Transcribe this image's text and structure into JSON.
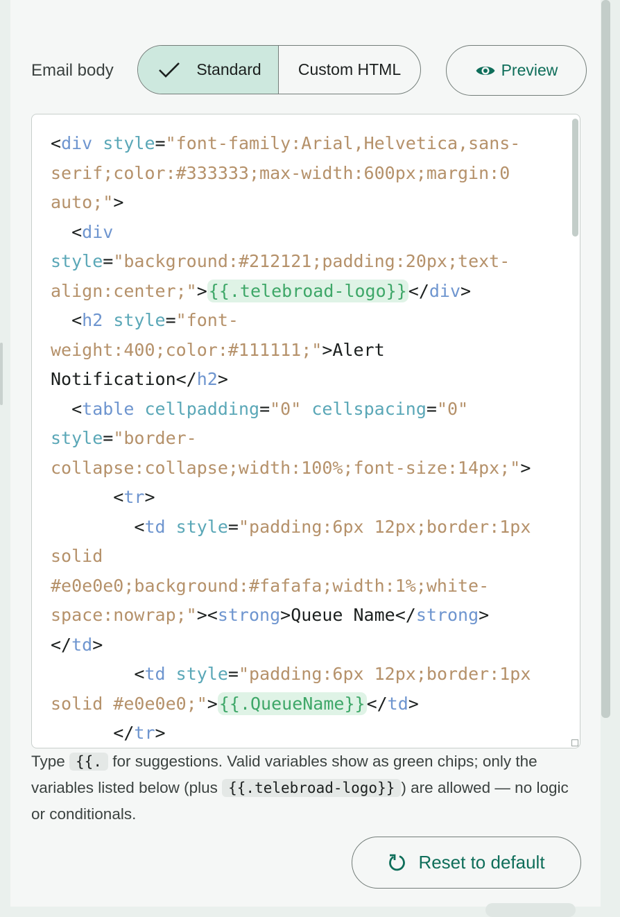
{
  "email_body": {
    "label": "Email body",
    "mode_options": [
      "Standard",
      "Custom HTML"
    ],
    "selected_mode": "Standard",
    "preview_label": "Preview"
  },
  "code_lines": [
    [
      [
        "p",
        "<"
      ],
      [
        "tag",
        "div"
      ],
      [
        "p",
        " "
      ],
      [
        "attr",
        "style"
      ],
      [
        "p",
        "="
      ],
      [
        "val",
        "\"font-family:Arial,Helvetica,sans-"
      ]
    ],
    [
      [
        "val",
        "serif;color:#333333;max-width:600px;margin:0"
      ]
    ],
    [
      [
        "val",
        "auto;\""
      ],
      [
        "p",
        ">"
      ]
    ],
    [
      [
        "p",
        "  <"
      ],
      [
        "tag",
        "div"
      ]
    ],
    [
      [
        "attr",
        "style"
      ],
      [
        "p",
        "="
      ],
      [
        "val",
        "\"background:#212121;padding:20px;text-"
      ]
    ],
    [
      [
        "val",
        "align:center;\""
      ],
      [
        "p",
        ">"
      ],
      [
        "chip",
        "{{.telebroad-logo}}"
      ],
      [
        "p",
        "</"
      ],
      [
        "tag",
        "div"
      ],
      [
        "p",
        ">"
      ]
    ],
    [
      [
        "p",
        "  <"
      ],
      [
        "tag",
        "h2"
      ],
      [
        "p",
        " "
      ],
      [
        "attr",
        "style"
      ],
      [
        "p",
        "="
      ],
      [
        "val",
        "\"font-"
      ]
    ],
    [
      [
        "val",
        "weight:400;color:#111111;\""
      ],
      [
        "p",
        ">"
      ],
      [
        "txt",
        "Alert"
      ]
    ],
    [
      [
        "txt",
        "Notification"
      ],
      [
        "p",
        "</"
      ],
      [
        "tag",
        "h2"
      ],
      [
        "p",
        ">"
      ]
    ],
    [
      [
        "p",
        "  <"
      ],
      [
        "tag",
        "table"
      ],
      [
        "p",
        " "
      ],
      [
        "attr",
        "cellpadding"
      ],
      [
        "p",
        "="
      ],
      [
        "val",
        "\"0\""
      ],
      [
        "p",
        " "
      ],
      [
        "attr",
        "cellspacing"
      ],
      [
        "p",
        "="
      ],
      [
        "val",
        "\"0\""
      ]
    ],
    [
      [
        "attr",
        "style"
      ],
      [
        "p",
        "="
      ],
      [
        "val",
        "\"border-"
      ]
    ],
    [
      [
        "val",
        "collapse:collapse;width:100%;font-size:14px;\""
      ],
      [
        "p",
        ">"
      ]
    ],
    [
      [
        "p",
        "      <"
      ],
      [
        "tag",
        "tr"
      ],
      [
        "p",
        ">"
      ]
    ],
    [
      [
        "p",
        "        <"
      ],
      [
        "tag",
        "td"
      ],
      [
        "p",
        " "
      ],
      [
        "attr",
        "style"
      ],
      [
        "p",
        "="
      ],
      [
        "val",
        "\"padding:6px 12px;border:1px"
      ]
    ],
    [
      [
        "val",
        "solid"
      ]
    ],
    [
      [
        "val",
        "#e0e0e0;background:#fafafa;width:1%;white-"
      ]
    ],
    [
      [
        "val",
        "space:nowrap;\""
      ],
      [
        "p",
        "><"
      ],
      [
        "tag",
        "strong"
      ],
      [
        "p",
        ">"
      ],
      [
        "txt",
        "Queue Name"
      ],
      [
        "p",
        "</"
      ],
      [
        "tag",
        "strong"
      ],
      [
        "p",
        ">"
      ]
    ],
    [
      [
        "p",
        "</"
      ],
      [
        "tag",
        "td"
      ],
      [
        "p",
        ">"
      ]
    ],
    [
      [
        "p",
        "        <"
      ],
      [
        "tag",
        "td"
      ],
      [
        "p",
        " "
      ],
      [
        "attr",
        "style"
      ],
      [
        "p",
        "="
      ],
      [
        "val",
        "\"padding:6px 12px;border:1px"
      ]
    ],
    [
      [
        "val",
        "solid #e0e0e0;\""
      ],
      [
        "p",
        ">"
      ],
      [
        "chip",
        "{{.QueueName}}"
      ],
      [
        "p",
        "</"
      ],
      [
        "tag",
        "td"
      ],
      [
        "p",
        ">"
      ]
    ],
    [
      [
        "p",
        "      </"
      ],
      [
        "tag",
        "tr"
      ],
      [
        "p",
        ">"
      ]
    ]
  ],
  "help": {
    "part1": "Type ",
    "code1": "{{.",
    "part2": " for suggestions. Valid variables show as green chips; only the variables listed below (plus ",
    "code2": "{{.telebroad-logo}}",
    "part3": ") are allowed — no logic or conditionals."
  },
  "reset_label": "Reset to default",
  "colors": {
    "accent": "#0f6e5a",
    "selected_segment": "#cde8de",
    "chip_bg": "#dff3e6",
    "chip_text": "#3ea768",
    "tag": "#6e95cf",
    "attr": "#5aa7b7",
    "value": "#b5916a"
  },
  "icons": [
    "check-icon",
    "eye-icon",
    "reset-icon"
  ]
}
